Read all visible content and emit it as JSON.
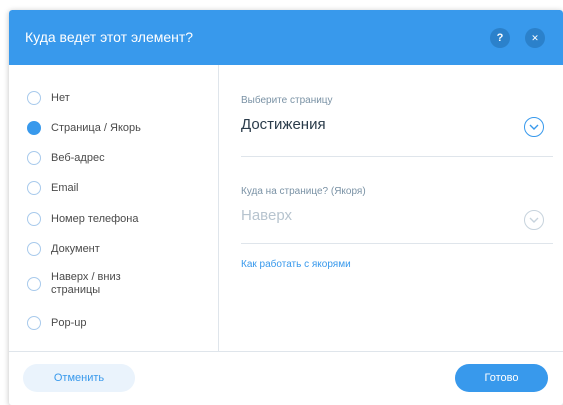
{
  "dialog": {
    "title": "Куда ведет этот элемент?",
    "help_symbol": "?",
    "close_symbol": "✕"
  },
  "link_types": [
    {
      "label": "Нет",
      "selected": false
    },
    {
      "label": "Страница / Якорь",
      "selected": true
    },
    {
      "label": "Веб-адрес",
      "selected": false
    },
    {
      "label": "Email",
      "selected": false
    },
    {
      "label": "Номер телефона",
      "selected": false
    },
    {
      "label": "Документ",
      "selected": false
    },
    {
      "label": "Наверх / вниз страницы",
      "selected": false
    },
    {
      "label": "Pop-up",
      "selected": false
    }
  ],
  "page_select": {
    "label": "Выберите страницу",
    "value": "Достижения"
  },
  "anchor_select": {
    "label": "Куда на странице? (Якоря)",
    "value": "Наверх",
    "disabled": true
  },
  "help_link": "Как работать с якорями",
  "footer": {
    "cancel_label": "Отменить",
    "done_label": "Готово"
  },
  "colors": {
    "accent": "#3899ec",
    "header": "#3899ec",
    "text": "#2b3c4b",
    "muted": "#7a92a5"
  },
  "icons": {
    "help": "help-icon",
    "close": "close-icon",
    "chevron": "chevron-down-icon"
  }
}
